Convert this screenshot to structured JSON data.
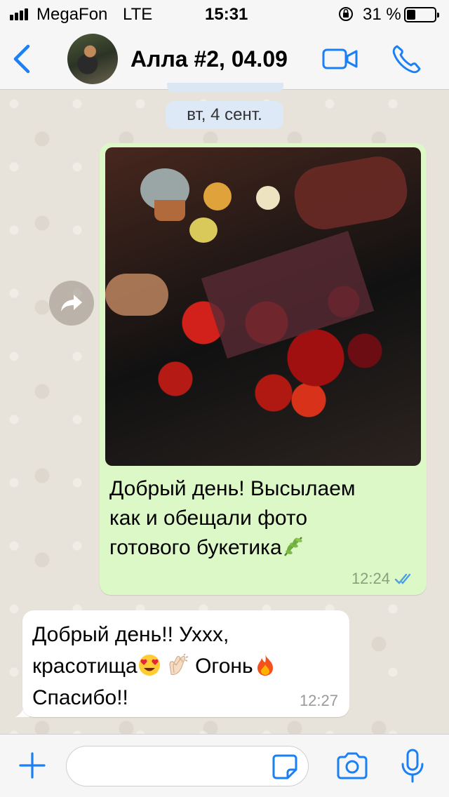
{
  "status_bar": {
    "carrier": "MegaFon",
    "network": "LTE",
    "time": "15:31",
    "battery_percent": "31 %",
    "battery_level": 0.31
  },
  "header": {
    "back_icon": "chevron-left-icon",
    "title": "Алла #2, 04.09",
    "video_icon": "video-camera-icon",
    "call_icon": "phone-icon"
  },
  "chat": {
    "date_chip": "вт, 4 сент.",
    "messages": [
      {
        "direction": "outgoing",
        "has_photo": true,
        "text": "Добрый день! Высылаем\nкак и обещали фото\nготового букетика",
        "trailing_emoji": "herb-leaf-emoji",
        "time": "12:24",
        "status": "read"
      },
      {
        "direction": "incoming",
        "line1": "Добрый день!! Уххх,",
        "line2_a": "красотища",
        "line2_b": "Огонь",
        "line3": "Спасибо!!",
        "emojis": [
          "heart-eyes-emoji",
          "clapping-hands-emoji",
          "fire-emoji"
        ],
        "time": "12:27"
      }
    ]
  },
  "input_bar": {
    "attach_icon": "plus-icon",
    "placeholder": "",
    "sticker_icon": "sticker-icon",
    "camera_icon": "camera-icon",
    "mic_icon": "microphone-icon"
  },
  "colors": {
    "accent": "#1b7ff5",
    "outgoing_bubble": "#dcf8c6",
    "incoming_bubble": "#ffffff",
    "date_chip": "#dde9f6"
  }
}
